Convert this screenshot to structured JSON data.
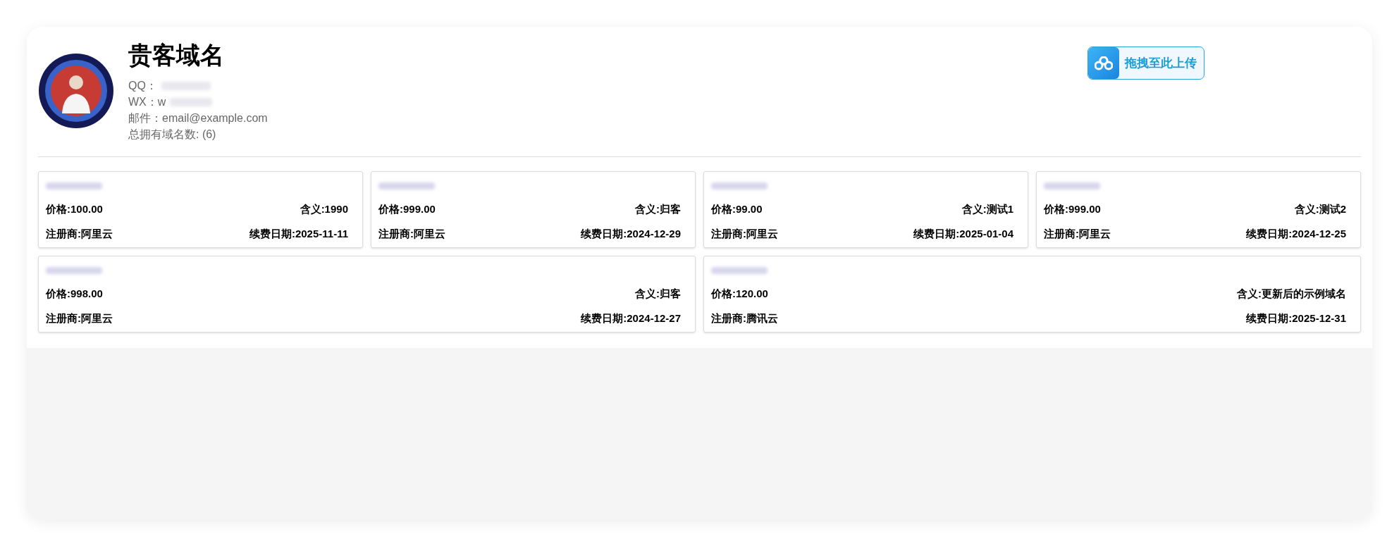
{
  "profile": {
    "title": "贵客域名",
    "qq_label": "QQ：",
    "wx_label": "WX：w",
    "email": "邮件：email@example.com",
    "count": "总拥有域名数: (6)"
  },
  "upload_button": {
    "label": "拖拽至此上传"
  },
  "domain_rows": [
    [
      {
        "price": "价格:100.00",
        "meaning": "含义:1990",
        "registrar": "注册商:阿里云",
        "renewal": "续费日期:2025-11-11"
      },
      {
        "price": "价格:999.00",
        "meaning": "含义:归客",
        "registrar": "注册商:阿里云",
        "renewal": "续费日期:2024-12-29"
      },
      {
        "price": "价格:99.00",
        "meaning": "含义:测试1",
        "registrar": "注册商:阿里云",
        "renewal": "续费日期:2025-01-04"
      },
      {
        "price": "价格:999.00",
        "meaning": "含义:测试2",
        "registrar": "注册商:阿里云",
        "renewal": "续费日期:2024-12-25"
      }
    ],
    [
      {
        "price": "价格:998.00",
        "meaning": "含义:归客",
        "registrar": "注册商:阿里云",
        "renewal": "续费日期:2024-12-27"
      },
      {
        "price": "价格:120.00",
        "meaning": "含义:更新后的示例域名",
        "registrar": "注册商:腾讯云",
        "renewal": "续费日期:2025-12-31"
      }
    ]
  ]
}
